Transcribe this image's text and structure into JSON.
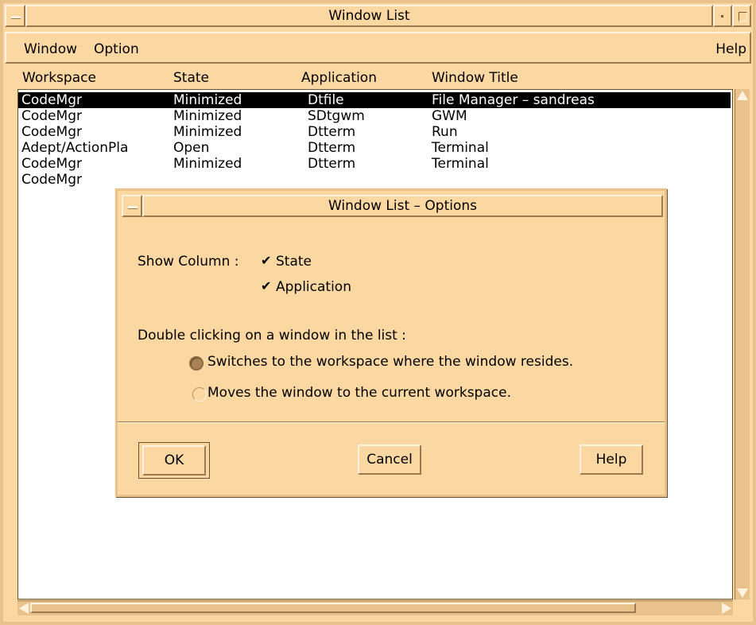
{
  "window": {
    "title": "Window List"
  },
  "menubar": {
    "window": "Window",
    "option": "Option",
    "help": "Help"
  },
  "columns": {
    "workspace": "Workspace",
    "state": "State",
    "application": "Application",
    "title": "Window Title"
  },
  "rows": [
    {
      "workspace": "CodeMgr",
      "state": "Minimized",
      "application": "Dtfile",
      "title": "File Manager – sandreas",
      "selected": true
    },
    {
      "workspace": "CodeMgr",
      "state": "Minimized",
      "application": "SDtgwm",
      "title": "GWM"
    },
    {
      "workspace": "CodeMgr",
      "state": "Minimized",
      "application": "Dtterm",
      "title": "Run"
    },
    {
      "workspace": "Adept/ActionPla",
      "state": "Open",
      "application": "Dtterm",
      "title": "Terminal"
    },
    {
      "workspace": "CodeMgr",
      "state": "Minimized",
      "application": "Dtterm",
      "title": "Terminal"
    },
    {
      "workspace": "CodeMgr",
      "state": "",
      "application": "",
      "title": ""
    }
  ],
  "dialog": {
    "title": "Window List – Options",
    "show_column_label": "Show Column :",
    "show_state": {
      "label": "State",
      "checked": true
    },
    "show_application": {
      "label": "Application",
      "checked": true
    },
    "double_click_label": "Double clicking on a window in the list :",
    "radio_switch": {
      "label": "Switches to the workspace where the window resides.",
      "selected": true
    },
    "radio_move": {
      "label": "Moves the window to the current workspace.",
      "selected": false
    },
    "ok": "OK",
    "cancel": "Cancel",
    "help": "Help"
  },
  "icons": {
    "check": "✔"
  },
  "colors": {
    "background": "#fbd7a1",
    "list_bg": "#ffffff",
    "selection": "#000000"
  }
}
